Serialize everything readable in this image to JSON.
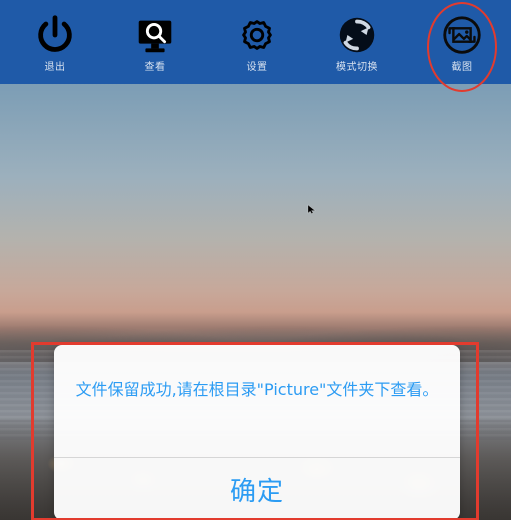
{
  "toolbar": {
    "items": [
      {
        "label": "退出",
        "icon": "power-icon"
      },
      {
        "label": "查看",
        "icon": "monitor-search-icon"
      },
      {
        "label": "设置",
        "icon": "gear-icon"
      },
      {
        "label": "模式切换",
        "icon": "mode-switch-icon"
      },
      {
        "label": "截图",
        "icon": "screenshot-icon"
      }
    ]
  },
  "dialog": {
    "message": "文件保留成功,请在根目录\"Picture\"文件夹下查看。",
    "confirm_label": "确定"
  },
  "colors": {
    "toolbar_bg": "#1f5aa8",
    "accent_blue": "#2c9cf3",
    "annotation_red": "#e23b2e"
  }
}
